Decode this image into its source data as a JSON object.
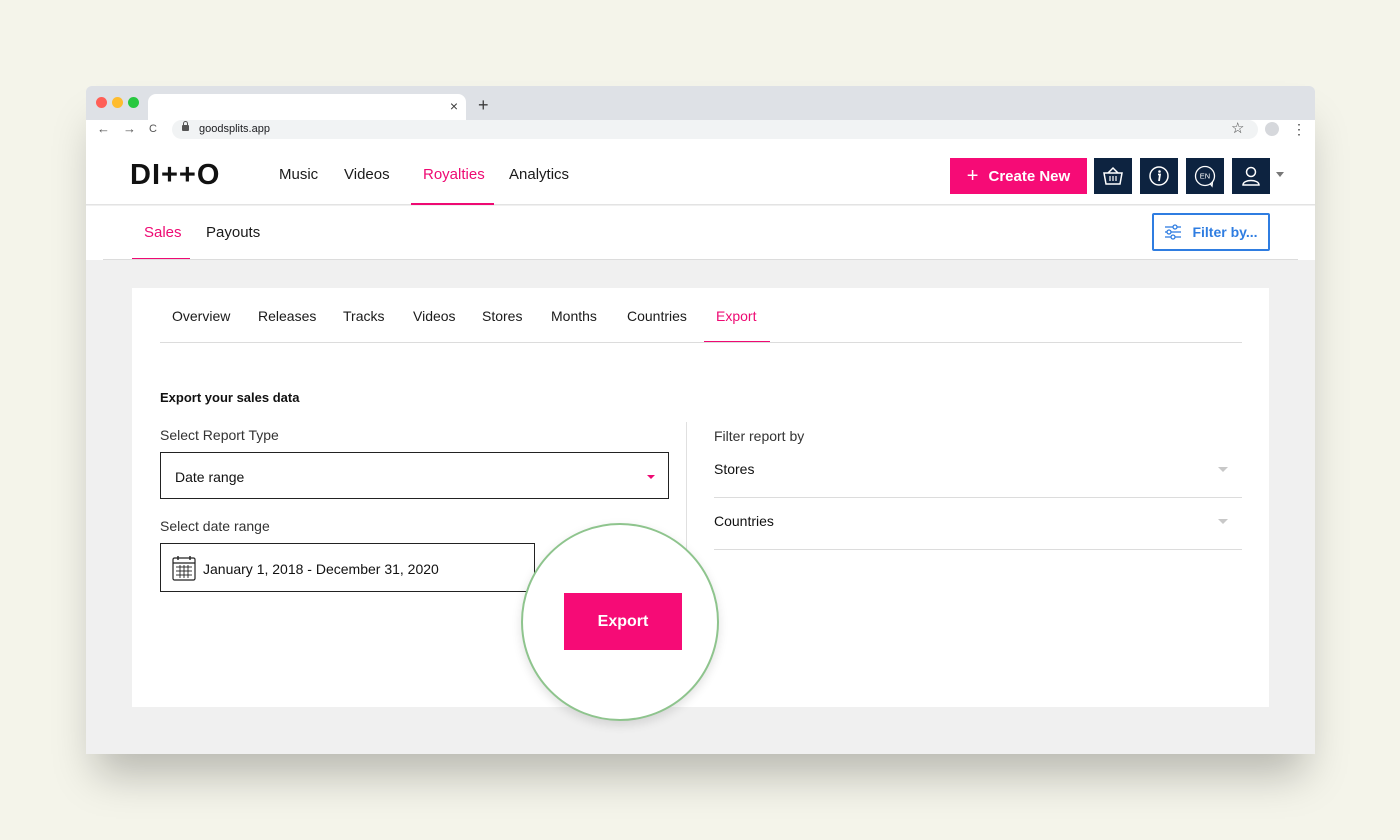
{
  "browser": {
    "url": "goodsplits.app",
    "tab_close": "×",
    "new_tab": "+",
    "back": "←",
    "forward": "→",
    "reload": "C",
    "star": "☆",
    "menu": "⋮"
  },
  "header": {
    "logo": "DI++O",
    "nav": [
      {
        "label": "Music"
      },
      {
        "label": "Videos"
      },
      {
        "label": "Royalties",
        "active": true
      },
      {
        "label": "Analytics"
      }
    ],
    "create_label": "Create New",
    "plus": "+",
    "icons": [
      "basket-icon",
      "info-icon",
      "language-icon",
      "user-icon",
      "chevron-down-icon"
    ],
    "language": "EN"
  },
  "subnav": {
    "items": [
      {
        "label": "Sales",
        "active": true
      },
      {
        "label": "Payouts"
      }
    ],
    "filter_label": "Filter by..."
  },
  "card": {
    "tabs": [
      {
        "label": "Overview"
      },
      {
        "label": "Releases"
      },
      {
        "label": "Tracks"
      },
      {
        "label": "Videos"
      },
      {
        "label": "Stores"
      },
      {
        "label": "Months"
      },
      {
        "label": "Countries"
      },
      {
        "label": "Export",
        "active": true
      }
    ],
    "section_title": "Export your sales data",
    "report_type_label": "Select Report Type",
    "report_type_value": "Date range",
    "date_range_label": "Select date range",
    "date_range_value": "January 1, 2018 - December 31, 2020",
    "filter_heading": "Filter report by",
    "filter_rows": [
      {
        "label": "Stores"
      },
      {
        "label": "Countries"
      }
    ],
    "export_label": "Export"
  },
  "colors": {
    "accent_pink": "#f60b76",
    "navy": "#0d2340",
    "filter_blue": "#2f7de1",
    "highlight_green": "#8ec48d"
  }
}
